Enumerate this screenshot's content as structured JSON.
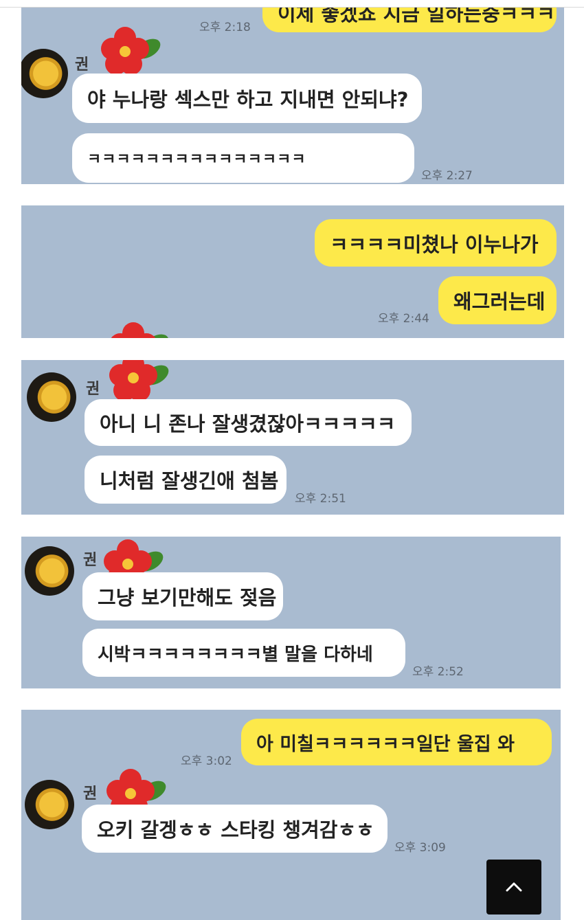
{
  "nickname": "권",
  "panels": [
    {
      "name": "chat-panel-1",
      "messages": [
        {
          "side": "right",
          "text": "이제 좋겠죠 지금 일하는중ㅋㅋㅋ",
          "time": "오후 2:18"
        },
        {
          "side": "left",
          "text": "야 누나랑 섹스만 하고 지내면 안되냐?"
        },
        {
          "side": "left",
          "text": "ㅋㅋㅋㅋㅋㅋㅋㅋㅋㅋㅋㅋㅋㅋㅋ",
          "time": "오후 2:27"
        }
      ]
    },
    {
      "name": "chat-panel-2",
      "messages": [
        {
          "side": "right",
          "text": "ㅋㅋㅋㅋ미쳤나 이누나가"
        },
        {
          "side": "right",
          "text": "왜그러는데",
          "time": "오후 2:44"
        }
      ]
    },
    {
      "name": "chat-panel-3",
      "messages": [
        {
          "side": "left",
          "text": "아니 니 존나 잘생겼잖아ㅋㅋㅋㅋㅋ"
        },
        {
          "side": "left",
          "text": "니처럼 잘생긴애 첨봄",
          "time": "오후 2:51"
        }
      ]
    },
    {
      "name": "chat-panel-4",
      "messages": [
        {
          "side": "left",
          "text": "그냥 보기만해도 젖음"
        },
        {
          "side": "left",
          "text": "시박ㅋㅋㅋㅋㅋㅋㅋㅋ별 말을 다하네",
          "time": "오후 2:52"
        }
      ]
    },
    {
      "name": "chat-panel-5",
      "messages": [
        {
          "side": "right",
          "text": "아 미칠ㅋㅋㅋㅋㅋㅋ일단 울집 와",
          "time": "오후 3:02"
        },
        {
          "side": "left",
          "text": "오키 갈겡ㅎㅎ 스타킹 챙겨감ㅎㅎ",
          "time": "오후 3:09"
        }
      ]
    }
  ],
  "scroll_top": {
    "icon": "chevron-up-icon"
  },
  "colors": {
    "chat_bg": "#a9bbd0",
    "my_bubble": "#fde94a",
    "their_bubble": "#ffffff"
  }
}
